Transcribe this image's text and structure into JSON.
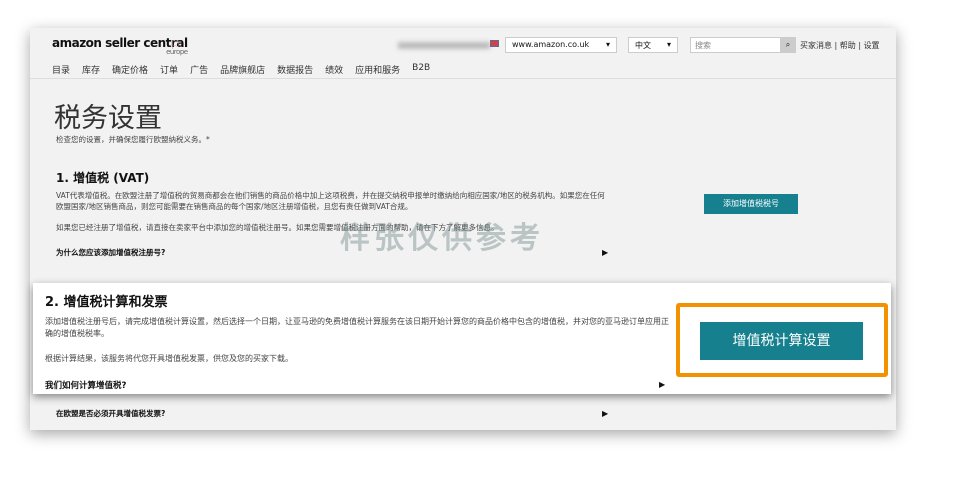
{
  "header": {
    "logo": "amazon seller central",
    "logo_sub": "europe",
    "marketplace": "www.amazon.co.uk",
    "language": "中文",
    "search_placeholder": "搜索",
    "links": [
      "买家消息",
      "帮助",
      "设置"
    ]
  },
  "nav": [
    "目录",
    "库存",
    "确定价格",
    "订单",
    "广告",
    "品牌旗舰店",
    "数据报告",
    "绩效",
    "应用和服务",
    "B2B"
  ],
  "page": {
    "title": "税务设置",
    "subtitle": "检查您的设置，并确保您履行欧盟纳税义务。*"
  },
  "vat": {
    "heading": "1. 增值税 (VAT)",
    "p1": "VAT代表增值税。在欧盟注册了增值税的贸易商都会在他们销售的商品价格中加上这项税费，并在提交纳税申报单时缴纳给向相应国家/地区的税务机构。如果您在任何欧盟国家/地区销售商品，则您可能需要在销售商品的每个国家/地区注册增值税，且您有责任做到VAT合规。",
    "p2": "如果您已经注册了增值税，请直接在卖家平台中添加您的增值税注册号。如果您需要增值税注册方面的帮助，请在下方了解更多信息。",
    "faq": "为什么您应该添加增值税注册号?",
    "button": "添加增值税税号"
  },
  "watermark": "样张仅供参考",
  "calc": {
    "heading": "2. 增值税计算和发票",
    "p1": "添加增值税注册号后，请完成增值税计算设置，然后选择一个日期，让亚马逊的免费增值税计算服务在该日期开始计算您的商品价格中包含的增值税，并对您的亚马逊订单应用正确的增值税税率。",
    "p2": "根据计算结果，该服务将代您开具增值税发票，供您及您的买家下载。",
    "faq": "我们如何计算增值税?",
    "button": "增值税计算设置"
  },
  "invoice_faq": "在欧盟是否必须开具增值税发票?"
}
